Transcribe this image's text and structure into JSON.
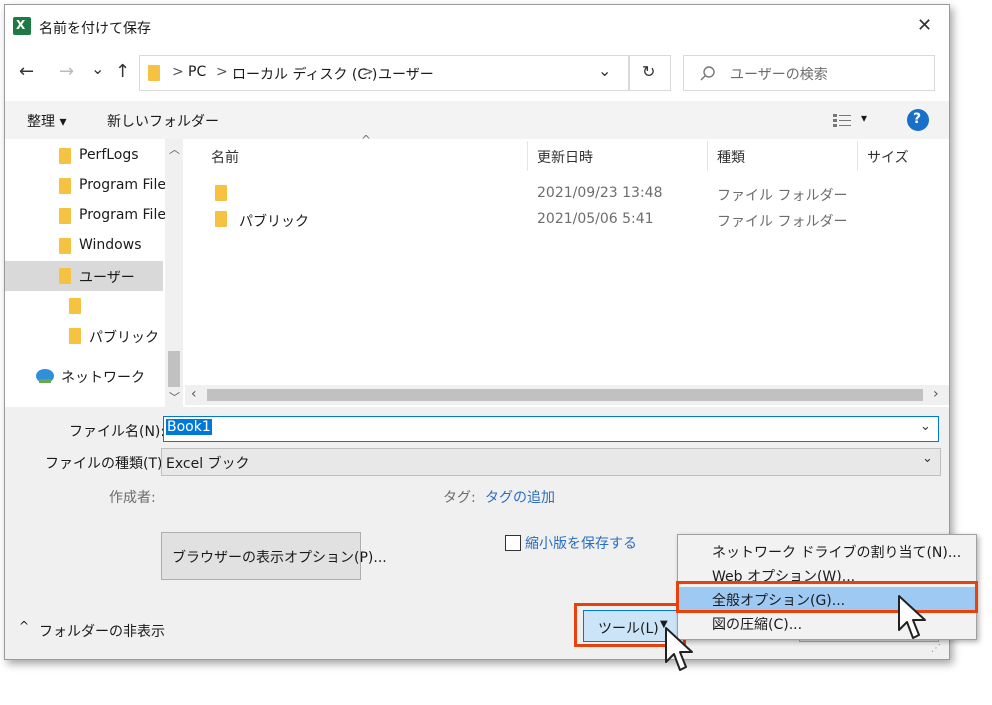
{
  "window": {
    "title": "名前を付けて保存",
    "close_glyph": "✕"
  },
  "nav": {
    "back": "←",
    "forward": "→",
    "recent": "⌄",
    "up": "↑",
    "breadcrumb": [
      "PC",
      "ローカル ディスク (C:)",
      "ユーザー"
    ],
    "separator": ">",
    "dropdown": "⌄",
    "refresh": "↻",
    "search_placeholder": "ユーザーの検索"
  },
  "toolbar": {
    "organize": "整理 ▾",
    "new_folder": "新しいフォルダー",
    "view_arrow": "▾",
    "help": "?"
  },
  "sidebar": {
    "items": [
      {
        "label": "PerfLogs"
      },
      {
        "label": "Program File"
      },
      {
        "label": "Program File"
      },
      {
        "label": "Windows"
      },
      {
        "label": "ユーザー"
      },
      {
        "label": ""
      },
      {
        "label": "パブリック"
      },
      {
        "label": "ネットワーク"
      }
    ]
  },
  "files": {
    "columns": [
      "名前",
      "更新日時",
      "種類",
      "サイズ"
    ],
    "rows": [
      {
        "name": "",
        "date": "2021/09/23 13:48",
        "type": "ファイル フォルダー"
      },
      {
        "name": "パブリック",
        "date": "2021/05/06 5:41",
        "type": "ファイル フォルダー"
      }
    ]
  },
  "form": {
    "filename_label": "ファイル名(N):",
    "filename_value": "Book1",
    "filetype_label": "ファイルの種類(T):",
    "filetype_value": "Excel ブック",
    "author_label": "作成者:",
    "tags_label": "タグ:",
    "tags_value": "タグの追加",
    "thumbnail_label": "縮小版を保存する",
    "browser_options": "ブラウザーの表示オプション(P)..."
  },
  "footer": {
    "hide_folders": "フォルダーの非表示",
    "tools": "ツール(L)",
    "tools_arrow": "▼"
  },
  "tools_menu": {
    "items": [
      "ネットワーク ドライブの割り当て(N)...",
      "Web オプション(W)...",
      "全般オプション(G)...",
      "図の圧縮(C)..."
    ],
    "highlighted_index": 2
  },
  "colors": {
    "accent": "#0078d7",
    "highlight": "#9ec9f2",
    "annotation": "#e8410c",
    "folder": "#f5c242"
  }
}
